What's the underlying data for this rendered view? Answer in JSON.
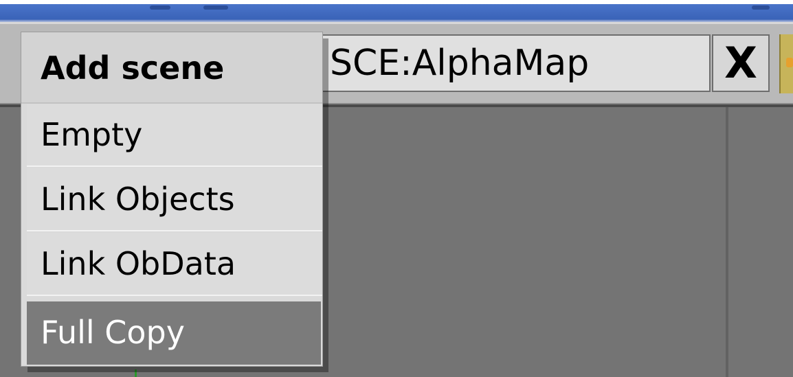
{
  "header": {
    "scene_name": "SCE:AlphaMap",
    "close_label": "X"
  },
  "add_scene_menu": {
    "title": "Add scene",
    "items": [
      {
        "label": "Empty",
        "selected": false
      },
      {
        "label": "Link Objects",
        "selected": false
      },
      {
        "label": "Link ObData",
        "selected": false
      },
      {
        "label": "Full Copy",
        "selected": true
      }
    ]
  },
  "colors": {
    "title_bar": "#3a63b8",
    "header_background": "#b9b9b9",
    "viewport_background": "#747474",
    "menu_background": "#dadada",
    "menu_highlight": "#7b7b7b"
  }
}
